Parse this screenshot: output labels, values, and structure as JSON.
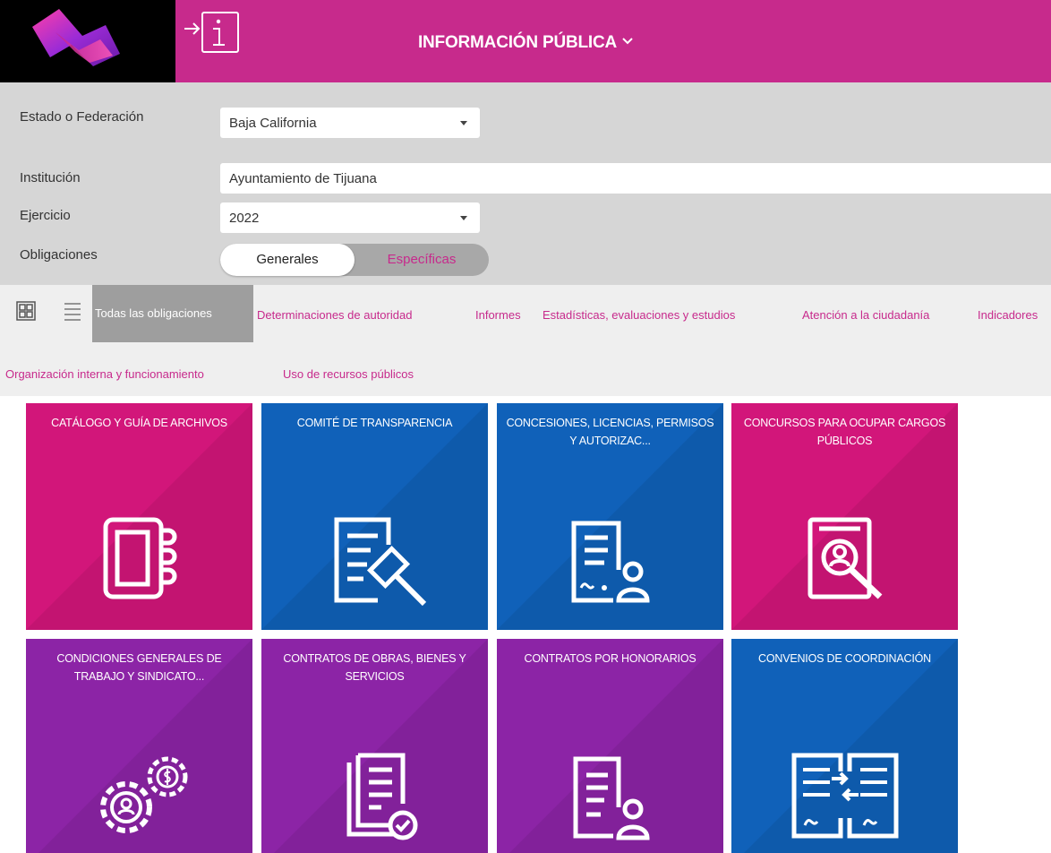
{
  "header": {
    "title": "INFORMACIÓN PÚBLICA",
    "bg_color": "#c72a8c",
    "logo_icon": "brand-logo-icon",
    "exit_icon": "exit-info-icon"
  },
  "filters": {
    "estado": {
      "label": "Estado o Federación",
      "value": "Baja California"
    },
    "institucion": {
      "label": "Institución",
      "value": "Ayuntamiento de Tijuana"
    },
    "ejercicio": {
      "label": "Ejercicio",
      "value": "2022"
    },
    "obligaciones": {
      "label": "Obligaciones",
      "option_on": "Generales",
      "option_off": "Específicas"
    }
  },
  "categories": {
    "active": "Todas las obligaciones",
    "links": [
      "Determinaciones de autoridad",
      "Informes",
      "Estadísticas, evaluaciones y estudios",
      "Atención a la ciudadanía",
      "Indicadores",
      "Organización interna y funcionamiento",
      "Uso de recursos públicos"
    ]
  },
  "tiles": [
    {
      "title": "CATÁLOGO Y GUÍA DE ARCHIVOS",
      "color": "#d2167a",
      "icon": "binder-icon"
    },
    {
      "title": "COMITÉ DE TRANSPARENCIA",
      "color": "#1061b9",
      "icon": "document-gavel-icon"
    },
    {
      "title": "CONCESIONES, LICENCIAS, PERMISOS Y AUTORIZAC...",
      "color": "#1061b9",
      "icon": "document-signature-user-icon"
    },
    {
      "title": "CONCURSOS PARA OCUPAR CARGOS PÚBLICOS",
      "color": "#d2167a",
      "icon": "document-search-user-icon"
    },
    {
      "title": "CONDICIONES GENERALES DE TRABAJO Y SINDICATO...",
      "color": "#8c24a6",
      "icon": "gears-user-money-icon"
    },
    {
      "title": "CONTRATOS DE OBRAS, BIENES Y SERVICIOS",
      "color": "#8c24a6",
      "icon": "documents-check-icon"
    },
    {
      "title": "CONTRATOS POR HONORARIOS",
      "color": "#8c24a6",
      "icon": "document-user-icon"
    },
    {
      "title": "CONVENIOS DE COORDINACIÓN",
      "color": "#1061b9",
      "icon": "documents-exchange-icon"
    }
  ]
}
